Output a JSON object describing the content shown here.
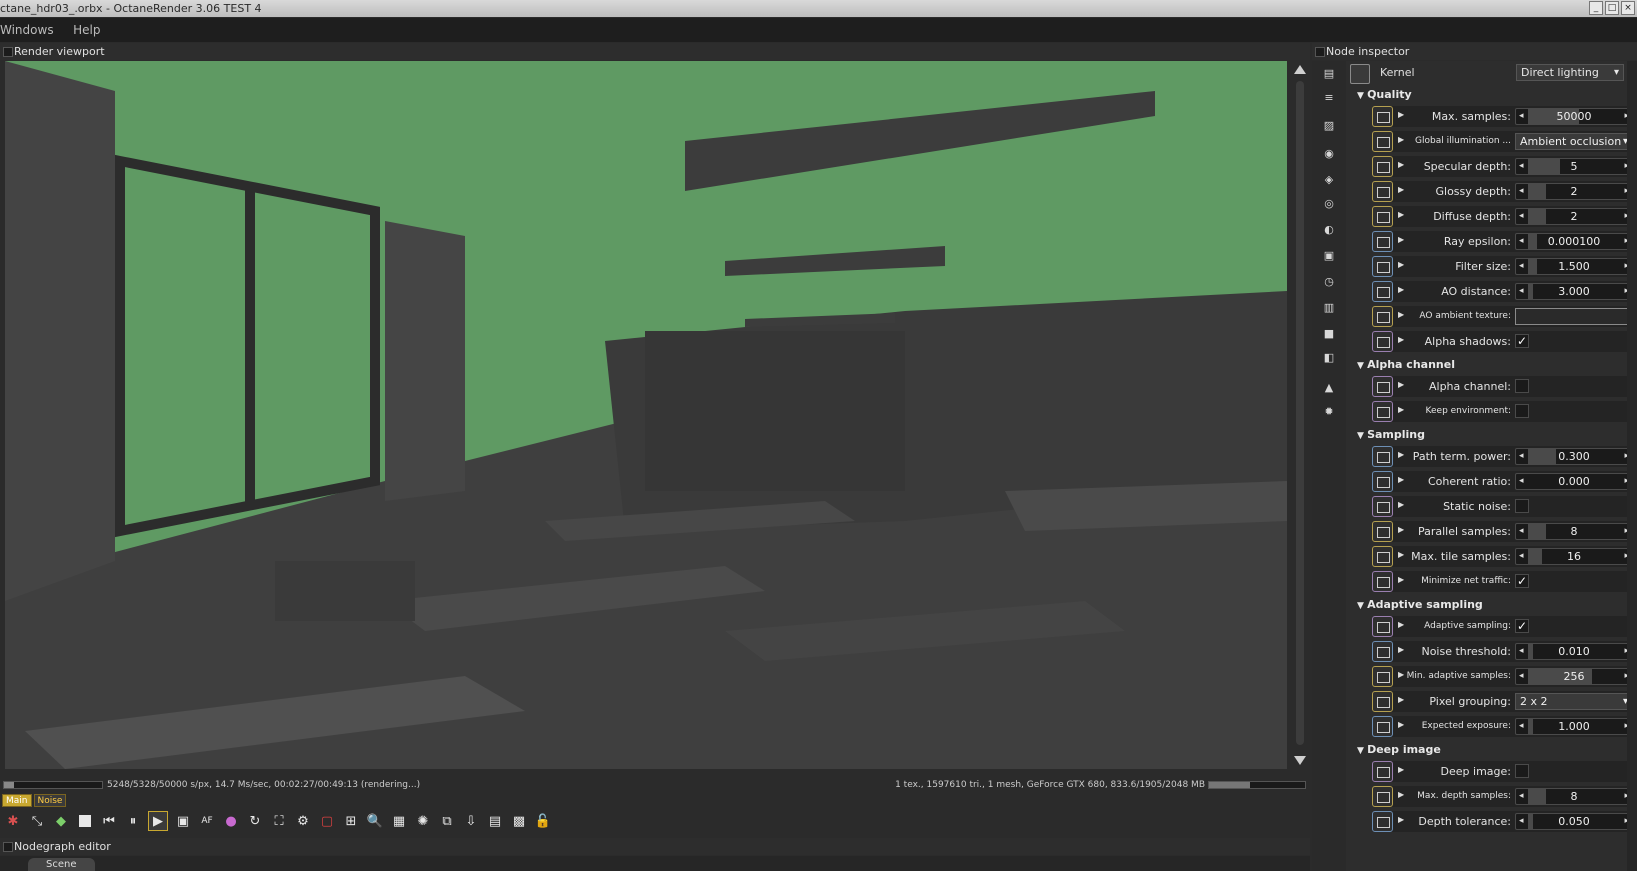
{
  "window": {
    "title": "ctane_hdr03_.orbx - OctaneRender 3.06 TEST 4"
  },
  "menu": [
    "Windows",
    "Help"
  ],
  "viewport": {
    "panel_title": "Render viewport"
  },
  "status": {
    "left": "5248/5328/50000 s/px, 14.7 Ms/sec, 00:02:27/00:49:13 (rendering...)",
    "right": "1 tex., 1597610 tri., 1 mesh, GeForce GTX 680, 833.6/1905/2048 MB",
    "progress": 0.1,
    "memory": 0.43
  },
  "tabs": [
    "Main",
    "Noise"
  ],
  "nodegraph": {
    "panel_title": "Nodegraph editor",
    "tab": "Scene"
  },
  "inspector": {
    "panel_title": "Node inspector",
    "kernel_label": "Kernel",
    "kernel_value": "Direct lighting",
    "sections": [
      {
        "title": "Quality",
        "rows": [
          {
            "label": "Max. samples:",
            "type": "spin",
            "value": "50000",
            "pin": "y",
            "fill": 0.55
          },
          {
            "label": "Global illumination ...",
            "type": "dd",
            "value": "Ambient occlusion",
            "pin": "y",
            "small": true
          },
          {
            "label": "Specular depth:",
            "type": "spin",
            "value": "5",
            "pin": "y",
            "fill": 0.35
          },
          {
            "label": "Glossy depth:",
            "type": "spin",
            "value": "2",
            "pin": "y",
            "fill": 0.2
          },
          {
            "label": "Diffuse depth:",
            "type": "spin",
            "value": "2",
            "pin": "y",
            "fill": 0.2
          },
          {
            "label": "Ray epsilon:",
            "type": "spin",
            "value": "0.000100",
            "pin": "b",
            "fill": 0.1
          },
          {
            "label": "Filter size:",
            "type": "spin",
            "value": "1.500",
            "pin": "b",
            "fill": 0.1
          },
          {
            "label": "AO distance:",
            "type": "spin",
            "value": "3.000",
            "pin": "b",
            "fill": 0.05
          },
          {
            "label": "AO ambient texture:",
            "type": "tex",
            "value": "",
            "pin": "y",
            "small": true
          },
          {
            "label": "Alpha shadows:",
            "type": "cb",
            "value": "✓",
            "pin": "v"
          }
        ]
      },
      {
        "title": "Alpha channel",
        "rows": [
          {
            "label": "Alpha channel:",
            "type": "cb",
            "value": "",
            "pin": "v"
          },
          {
            "label": "Keep environment:",
            "type": "cb",
            "value": "",
            "pin": "v",
            "small": true
          }
        ]
      },
      {
        "title": "Sampling",
        "rows": [
          {
            "label": "Path term. power:",
            "type": "spin",
            "value": "0.300",
            "pin": "b",
            "fill": 0.3
          },
          {
            "label": "Coherent ratio:",
            "type": "spin",
            "value": "0.000",
            "pin": "b",
            "fill": 0.0
          },
          {
            "label": "Static noise:",
            "type": "cb",
            "value": "",
            "pin": "v"
          },
          {
            "label": "Parallel samples:",
            "type": "spin",
            "value": "8",
            "pin": "y",
            "fill": 0.2
          },
          {
            "label": "Max. tile samples:",
            "type": "spin",
            "value": "16",
            "pin": "y",
            "fill": 0.15
          },
          {
            "label": "Minimize net traffic:",
            "type": "cb",
            "value": "✓",
            "pin": "v",
            "small": true
          }
        ]
      },
      {
        "title": "Adaptive sampling",
        "rows": [
          {
            "label": "Adaptive sampling:",
            "type": "cb",
            "value": "✓",
            "pin": "v",
            "small": true
          },
          {
            "label": "Noise threshold:",
            "type": "spin",
            "value": "0.010",
            "pin": "b",
            "fill": 0.05
          },
          {
            "label": "Min. adaptive samples:",
            "type": "spin",
            "value": "256",
            "pin": "y",
            "fill": 0.7,
            "small": true
          },
          {
            "label": "Pixel grouping:",
            "type": "dd",
            "value": "2 x 2",
            "pin": "y"
          },
          {
            "label": "Expected exposure:",
            "type": "spin",
            "value": "1.000",
            "pin": "b",
            "fill": 0.05,
            "small": true
          }
        ]
      },
      {
        "title": "Deep image",
        "rows": [
          {
            "label": "Deep image:",
            "type": "cb",
            "value": "",
            "pin": "v"
          },
          {
            "label": "Max. depth samples:",
            "type": "spin",
            "value": "8",
            "pin": "y",
            "fill": 0.2,
            "small": true
          },
          {
            "label": "Depth tolerance:",
            "type": "spin",
            "value": "0.050",
            "pin": "b",
            "fill": 0.05
          }
        ]
      }
    ]
  },
  "colors": {
    "render_green": "#5f9a63",
    "panel": "#2d2d2d",
    "accent_yellow": "#c8a830"
  }
}
